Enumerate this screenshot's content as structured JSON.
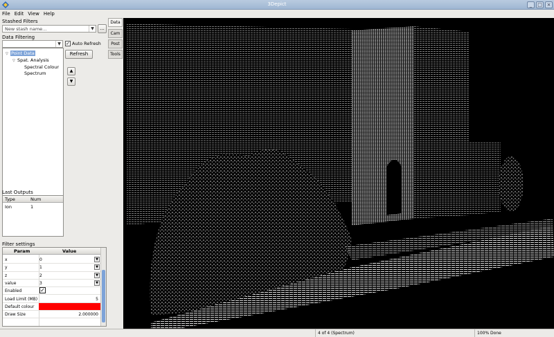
{
  "window": {
    "title": "3Depict"
  },
  "menu": [
    "File",
    "Edit",
    "View",
    "Help"
  ],
  "stash": {
    "heading": "Stashed Filters",
    "combo_value": "New stash name...",
    "more_button": "..."
  },
  "filtering": {
    "heading": "Data Filtering",
    "auto_refresh_label": "Auto Refresh",
    "auto_refresh_checked": true,
    "refresh_button": "Refresh"
  },
  "tree": {
    "items": [
      "Point Data",
      "Spat. Analysis",
      "Spectral Colour",
      "Spectrum"
    ]
  },
  "move_buttons": {
    "up": "▲",
    "down": "▼"
  },
  "outputs": {
    "heading": "Last Outputs",
    "columns": [
      "Type",
      "Num"
    ],
    "rows": [
      [
        "Ion",
        "1"
      ]
    ]
  },
  "filter_settings": {
    "heading": "Filter settings",
    "columns": [
      "Param",
      "Value"
    ],
    "rows": [
      {
        "param": "x",
        "value": "0"
      },
      {
        "param": "y",
        "value": "1"
      },
      {
        "param": "z",
        "value": "2"
      },
      {
        "param": "value",
        "value": "3"
      },
      {
        "param": "Enabled",
        "value": ""
      },
      {
        "param": "Load Limit (MB)",
        "value": "5"
      },
      {
        "param": "Default colour",
        "value": ""
      },
      {
        "param": "Draw Size",
        "value": "2.000000"
      }
    ],
    "default_colour": "#ff0000"
  },
  "side_tabs": [
    "Data",
    "Cam",
    "Post",
    "Tools"
  ],
  "status": {
    "left": "",
    "middle": "4 of 4 (Spectrum)",
    "right": "100% Done"
  }
}
